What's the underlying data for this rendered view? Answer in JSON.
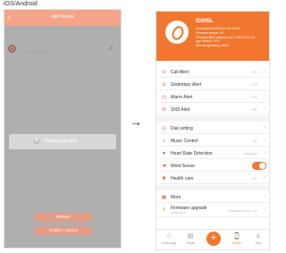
{
  "os_label": "iOS/Android",
  "left_screen": {
    "title": "Add Device",
    "back_icon": "chevron-left-icon",
    "prompt": "Please select a device",
    "device": {
      "name": "ID205L",
      "mac": "A4:C1:38:XX:XX:XX",
      "arrow": "→",
      "check": "✓"
    },
    "modal_text": "Binding device",
    "buttons": [
      "Refresh",
      "Confirm_Device"
    ]
  },
  "flow_arrow": "→",
  "right_screen": {
    "device_name": "ID205L",
    "device_info": [
      "Connected at 2019-XX-XX XX:XX",
      "Firmware version: V9",
      "Firmware MAC address: A4:C1:38:XX:XX:XX",
      "App Version: V2.X",
      "Remaining battery: 100%"
    ],
    "group1": [
      {
        "icon": "☏",
        "label": "Call Alert",
        "value": "OFF"
      },
      {
        "icon": "♙",
        "label": "Sedentary Alert",
        "value": "OFF"
      },
      {
        "icon": "◷",
        "label": "Alarm Alert",
        "value": "OFF"
      },
      {
        "icon": "✉",
        "label": "SNS Alert",
        "value": "OFF"
      }
    ],
    "group2": [
      {
        "icon": "◎",
        "label": "Dial setting",
        "value": ""
      },
      {
        "icon": "♫",
        "label": "Music Control",
        "value": "ON"
      },
      {
        "icon": "♥",
        "label": "Heart Rate Detection",
        "value": "Automatic"
      },
      {
        "icon": "☚",
        "label": "Wrist Sense",
        "value": "",
        "toggle": true
      },
      {
        "icon": "✚",
        "label": "Health care",
        "value": "OFF"
      }
    ],
    "more_label": "More",
    "firmware": {
      "label": "Firmware upgrade",
      "sub": "Y1.01.04.11",
      "value": "Firmware version: V9"
    },
    "tabs": [
      {
        "icon": "⌂",
        "label": "Home page"
      },
      {
        "icon": "▤",
        "label": "Details"
      },
      {
        "icon": "+",
        "label": ""
      },
      {
        "icon": "⌚",
        "label": "Device"
      },
      {
        "icon": "♙",
        "label": "User"
      }
    ],
    "colors": {
      "accent": "#f0772d"
    }
  }
}
